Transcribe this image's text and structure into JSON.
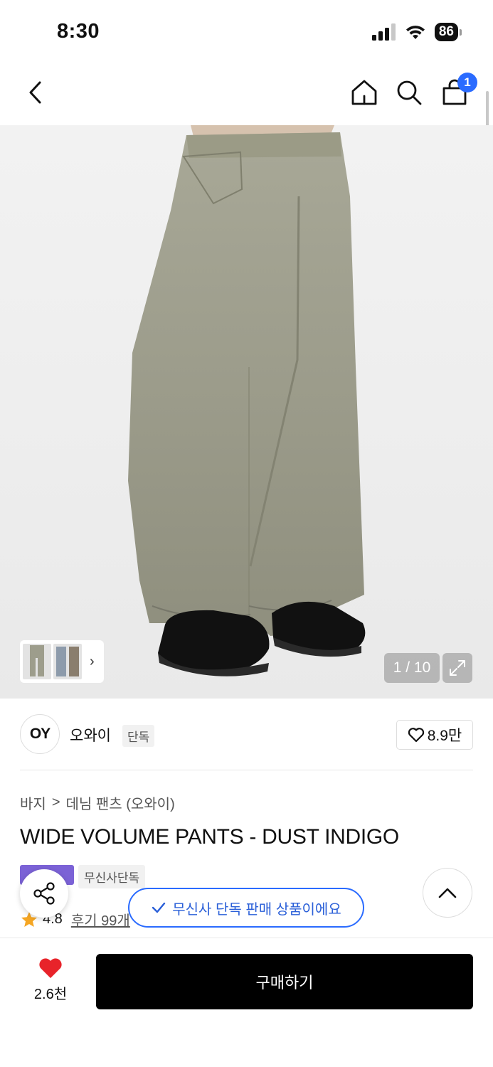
{
  "status_bar": {
    "time": "8:30",
    "battery": "86"
  },
  "nav": {
    "cart_count": "1"
  },
  "gallery": {
    "counter": "1 / 10"
  },
  "brand": {
    "logo_text": "OY",
    "name": "오와이",
    "tag": "단독",
    "likes": "8.9만"
  },
  "breadcrumb": {
    "category": "바지",
    "separator": ">",
    "subcategory": "데님 팬츠 (오와이)"
  },
  "product": {
    "title": "WIDE VOLUME PANTS - DUST INDIGO",
    "badge_exclusive": "무신사단독",
    "rating": "4.8",
    "reviews": "후기 99개"
  },
  "toast": {
    "text": "무신사 단독 판매 상품이에요"
  },
  "bottom": {
    "wish_count": "2.6천",
    "buy_label": "구매하기"
  },
  "colors": {
    "accent_blue": "#2a6bff",
    "badge_purple": "#7b62d6",
    "heart_red": "#e8232a"
  }
}
